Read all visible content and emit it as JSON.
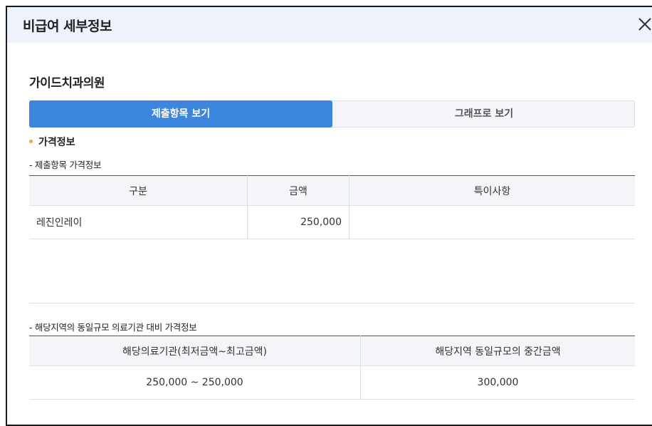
{
  "modal": {
    "title": "비급여 세부정보",
    "close_icon": "close-icon"
  },
  "clinic": {
    "name": "가이드치과의원"
  },
  "tabs": [
    {
      "label": "제출항목 보기",
      "active": true
    },
    {
      "label": "그래프로 보기",
      "active": false
    }
  ],
  "price_section": {
    "title": "가격정보",
    "bullet_color": "#f2a53a"
  },
  "submitted_table": {
    "subtitle": "- 제출항목 가격정보",
    "headers": [
      "구분",
      "금액",
      "특이사항"
    ],
    "rows": [
      {
        "item": "레진인레이",
        "amount": "250,000",
        "note": ""
      }
    ]
  },
  "regional_table": {
    "subtitle": "- 해당지역의 동일규모 의료기관 대비 가격정보",
    "headers": [
      "해당의료기관(최저금액~최고금액)",
      "해당지역 동일규모의 중간금액"
    ],
    "rows": [
      {
        "range": "250,000 ~ 250,000",
        "median": "300,000"
      }
    ]
  },
  "colors": {
    "accent": "#3c86dd",
    "header_bg": "#eef3fb",
    "table_header_bg": "#f3f5f8"
  }
}
